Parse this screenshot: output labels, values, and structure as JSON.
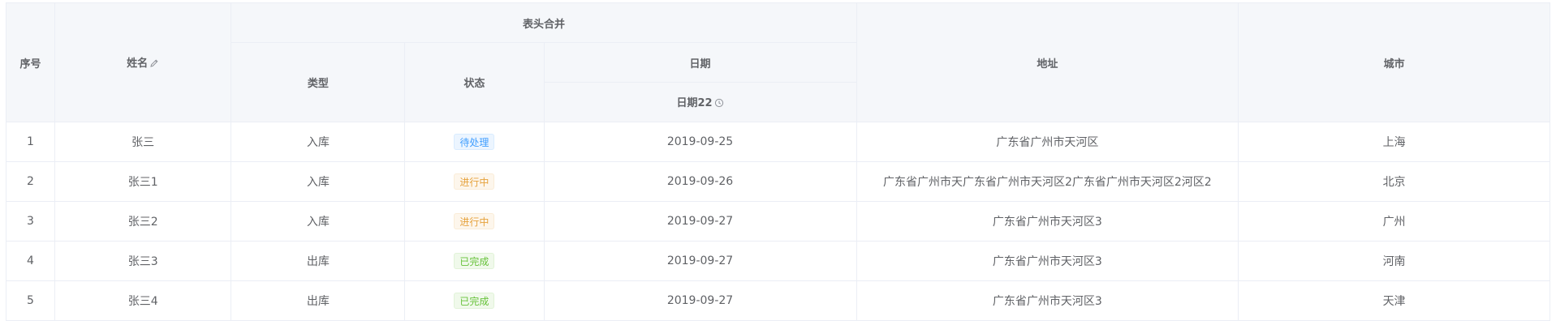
{
  "headers": {
    "index": "序号",
    "name": "姓名",
    "merged_group": "表头合并",
    "type": "类型",
    "status": "状态",
    "date_group": "日期",
    "date_sub": "日期22",
    "address": "地址",
    "city": "城市"
  },
  "rows": [
    {
      "index": "1",
      "name": "张三",
      "type": "入库",
      "status": "待处理",
      "status_kind": "info",
      "date": "2019-09-25",
      "address": "广东省广州市天河区",
      "city": "上海"
    },
    {
      "index": "2",
      "name": "张三1",
      "type": "入库",
      "status": "进行中",
      "status_kind": "warning",
      "date": "2019-09-26",
      "address": "广东省广州市天广东省广州市天河区2广东省广州市天河区2河区2",
      "city": "北京"
    },
    {
      "index": "3",
      "name": "张三2",
      "type": "入库",
      "status": "进行中",
      "status_kind": "warning",
      "date": "2019-09-27",
      "address": "广东省广州市天河区3",
      "city": "广州"
    },
    {
      "index": "4",
      "name": "张三3",
      "type": "出库",
      "status": "已完成",
      "status_kind": "success",
      "date": "2019-09-27",
      "address": "广东省广州市天河区3",
      "city": "河南"
    },
    {
      "index": "5",
      "name": "张三4",
      "type": "出库",
      "status": "已完成",
      "status_kind": "success",
      "date": "2019-09-27",
      "address": "广东省广州市天河区3",
      "city": "天津"
    }
  ],
  "colors": {
    "header_bg": "#f5f7fa",
    "border": "#ebeef5",
    "text": "#606266",
    "info": "#409eff",
    "warning": "#e6a23c",
    "success": "#67c23a"
  },
  "icons": {
    "name_header": "edit-icon",
    "date_sub_header": "clock-icon"
  }
}
